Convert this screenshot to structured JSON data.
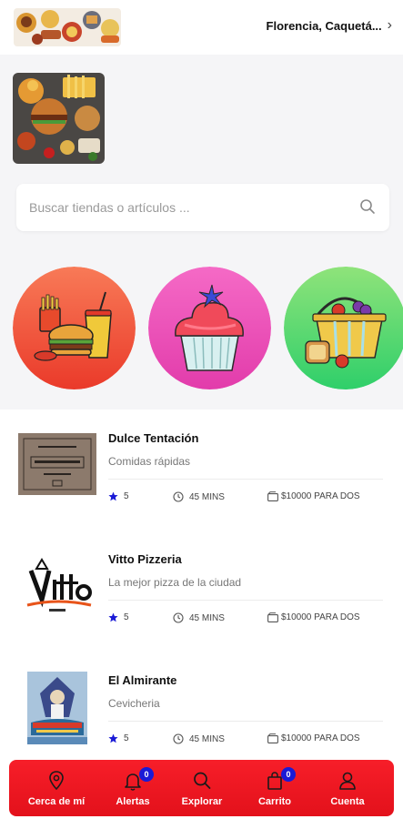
{
  "header": {
    "location": "Florencia, Caquetá..."
  },
  "search": {
    "placeholder": "Buscar tiendas o artículos ..."
  },
  "categories": [
    {
      "icon": "fast-food-icon"
    },
    {
      "icon": "cupcake-icon"
    },
    {
      "icon": "grocery-basket-icon"
    }
  ],
  "stores": [
    {
      "name": "Dulce Tentación",
      "description": "Comidas rápidas",
      "rating": "5",
      "time": "45 MINS",
      "price": "$10000 PARA DOS"
    },
    {
      "name": "Vitto Pizzeria",
      "description": "La mejor pizza de la ciudad",
      "rating": "5",
      "time": "45 MINS",
      "price": "$10000 PARA DOS"
    },
    {
      "name": "El Almirante",
      "description": "Cevicheria",
      "rating": "5",
      "time": "45 MINS",
      "price": "$10000 PARA DOS"
    }
  ],
  "nav": {
    "items": [
      {
        "label": "Cerca de mí"
      },
      {
        "label": "Alertas",
        "badge": "0"
      },
      {
        "label": "Explorar"
      },
      {
        "label": "Carrito",
        "badge": "0"
      },
      {
        "label": "Cuenta"
      }
    ]
  },
  "colors": {
    "nav_bg": "#f0161f",
    "badge": "#1a1ad6",
    "star": "#1a1ad6"
  }
}
